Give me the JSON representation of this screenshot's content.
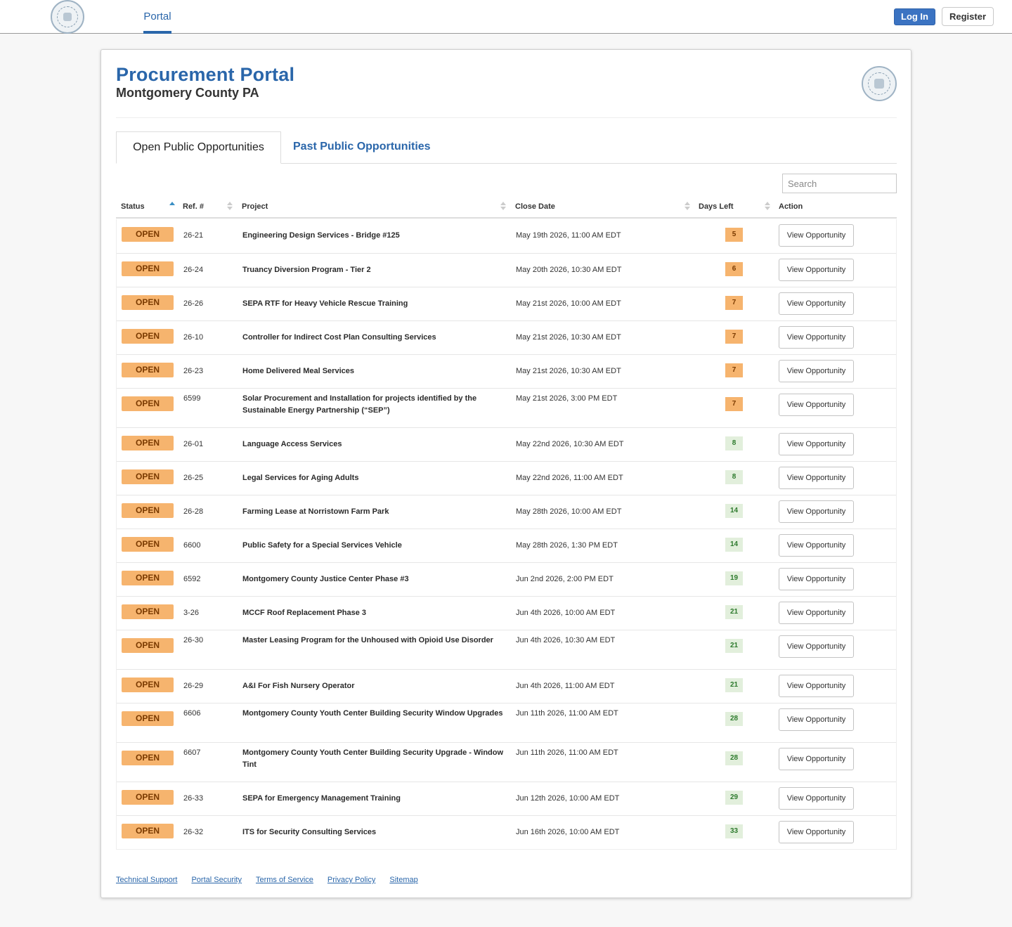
{
  "nav": {
    "portal_tab": "Portal",
    "login_label": "Log In",
    "register_label": "Register"
  },
  "header": {
    "title": "Procurement Portal",
    "subtitle": "Montgomery County PA"
  },
  "tabs": {
    "open": "Open Public Opportunities",
    "past": "Past Public Opportunities"
  },
  "search": {
    "placeholder": "Search"
  },
  "table": {
    "columns": {
      "status": "Status",
      "ref": "Ref. #",
      "project": "Project",
      "close_date": "Close Date",
      "days_left": "Days Left",
      "action": "Action"
    },
    "rows": [
      {
        "status": "OPEN",
        "ref": "26-21",
        "project": "Engineering Design Services - Bridge #125",
        "close_date": "May 19th 2026, 11:00 AM EDT",
        "days_left": "5",
        "urgency": "warn",
        "action": "View Opportunity"
      },
      {
        "status": "OPEN",
        "ref": "26-24",
        "project": "Truancy Diversion Program - Tier 2",
        "close_date": "May 20th 2026, 10:30 AM EDT",
        "days_left": "6",
        "urgency": "warn",
        "action": "View Opportunity"
      },
      {
        "status": "OPEN",
        "ref": "26-26",
        "project": "SEPA RTF for Heavy Vehicle Rescue Training",
        "close_date": "May 21st 2026, 10:00 AM EDT",
        "days_left": "7",
        "urgency": "warn",
        "action": "View Opportunity"
      },
      {
        "status": "OPEN",
        "ref": "26-10",
        "project": "Controller for Indirect Cost Plan Consulting Services",
        "close_date": "May 21st 2026, 10:30 AM EDT",
        "days_left": "7",
        "urgency": "warn",
        "action": "View Opportunity"
      },
      {
        "status": "OPEN",
        "ref": "26-23",
        "project": "Home Delivered Meal Services",
        "close_date": "May 21st 2026, 10:30 AM EDT",
        "days_left": "7",
        "urgency": "warn",
        "action": "View Opportunity"
      },
      {
        "status": "OPEN",
        "ref": "6599",
        "project": "Solar Procurement and Installation for projects identified by the Sustainable Energy Partnership (“SEP”)",
        "close_date": "May 21st 2026, 3:00 PM EDT",
        "days_left": "7",
        "urgency": "warn",
        "action": "View Opportunity"
      },
      {
        "status": "OPEN",
        "ref": "26-01",
        "project": "Language Access Services",
        "close_date": "May 22nd 2026, 10:30 AM EDT",
        "days_left": "8",
        "urgency": "ok",
        "action": "View Opportunity"
      },
      {
        "status": "OPEN",
        "ref": "26-25",
        "project": "Legal Services for Aging Adults",
        "close_date": "May 22nd 2026, 11:00 AM EDT",
        "days_left": "8",
        "urgency": "ok",
        "action": "View Opportunity"
      },
      {
        "status": "OPEN",
        "ref": "26-28",
        "project": "Farming Lease at Norristown Farm Park",
        "close_date": "May 28th 2026, 10:00 AM EDT",
        "days_left": "14",
        "urgency": "ok",
        "action": "View Opportunity"
      },
      {
        "status": "OPEN",
        "ref": "6600",
        "project": "Public Safety for a Special Services Vehicle",
        "close_date": "May 28th 2026, 1:30 PM EDT",
        "days_left": "14",
        "urgency": "ok",
        "action": "View Opportunity"
      },
      {
        "status": "OPEN",
        "ref": "6592",
        "project": "Montgomery County Justice Center Phase #3",
        "close_date": "Jun 2nd 2026, 2:00 PM EDT",
        "days_left": "19",
        "urgency": "ok",
        "action": "View Opportunity"
      },
      {
        "status": "OPEN",
        "ref": "3-26",
        "project": "MCCF Roof Replacement Phase 3",
        "close_date": "Jun 4th 2026, 10:00 AM EDT",
        "days_left": "21",
        "urgency": "ok",
        "action": "View Opportunity"
      },
      {
        "status": "OPEN",
        "ref": "26-30",
        "project": "Master Leasing Program for the Unhoused with Opioid Use Disorder",
        "close_date": "Jun 4th 2026, 10:30 AM EDT",
        "days_left": "21",
        "urgency": "ok",
        "action": "View Opportunity"
      },
      {
        "status": "OPEN",
        "ref": "26-29",
        "project": "A&I For Fish Nursery Operator",
        "close_date": "Jun 4th 2026, 11:00 AM EDT",
        "days_left": "21",
        "urgency": "ok",
        "action": "View Opportunity"
      },
      {
        "status": "OPEN",
        "ref": "6606",
        "project": "Montgomery County Youth Center Building Security Window Upgrades",
        "close_date": "Jun 11th 2026, 11:00 AM EDT",
        "days_left": "28",
        "urgency": "ok",
        "action": "View Opportunity"
      },
      {
        "status": "OPEN",
        "ref": "6607",
        "project": "Montgomery County Youth Center Building Security Upgrade - Window Tint",
        "close_date": "Jun 11th 2026, 11:00 AM EDT",
        "days_left": "28",
        "urgency": "ok",
        "action": "View Opportunity"
      },
      {
        "status": "OPEN",
        "ref": "26-33",
        "project": "SEPA for Emergency Management Training",
        "close_date": "Jun 12th 2026, 10:00 AM EDT",
        "days_left": "29",
        "urgency": "ok",
        "action": "View Opportunity"
      },
      {
        "status": "OPEN",
        "ref": "26-32",
        "project": "ITS for Security Consulting Services",
        "close_date": "Jun 16th 2026, 10:00 AM EDT",
        "days_left": "33",
        "urgency": "ok",
        "action": "View Opportunity"
      }
    ]
  },
  "footer": {
    "links": [
      "Technical Support",
      "Portal Security",
      "Terms of Service",
      "Privacy Policy",
      "Sitemap"
    ]
  },
  "colors": {
    "brand": "#2a66aa",
    "status_open": "#f6b46e",
    "days_warn": "#f6b46e",
    "days_ok": "#e2efdc"
  }
}
